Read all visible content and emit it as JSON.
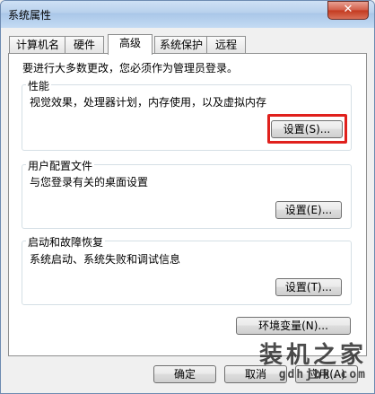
{
  "window": {
    "title": "系统属性",
    "close_glyph": "✕"
  },
  "tabs": [
    {
      "label": "计算机名",
      "active": false
    },
    {
      "label": "硬件",
      "active": false
    },
    {
      "label": "高级",
      "active": true
    },
    {
      "label": "系统保护",
      "active": false
    },
    {
      "label": "远程",
      "active": false
    }
  ],
  "admin_note": "要进行大多数更改，您必须作为管理员登录。",
  "performance": {
    "title": "性能",
    "description": "视觉效果，处理器计划，内存使用，以及虚拟内存",
    "button": "设置(S)..."
  },
  "user_profiles": {
    "title": "用户配置文件",
    "description": "与您登录有关的桌面设置",
    "button": "设置(E)..."
  },
  "startup_recovery": {
    "title": "启动和故障恢复",
    "description": "系统启动、系统失败和调试信息",
    "button": "设置(T)..."
  },
  "env_button": "环境变量(N)...",
  "footer": {
    "ok": "确定",
    "cancel": "取消",
    "apply": "应用(A)"
  },
  "watermark": {
    "cn": "装机之家",
    "en": "gdhjbk.com"
  },
  "colors": {
    "highlight_border": "#e0201c",
    "title_bar": "#b7d0ec"
  }
}
